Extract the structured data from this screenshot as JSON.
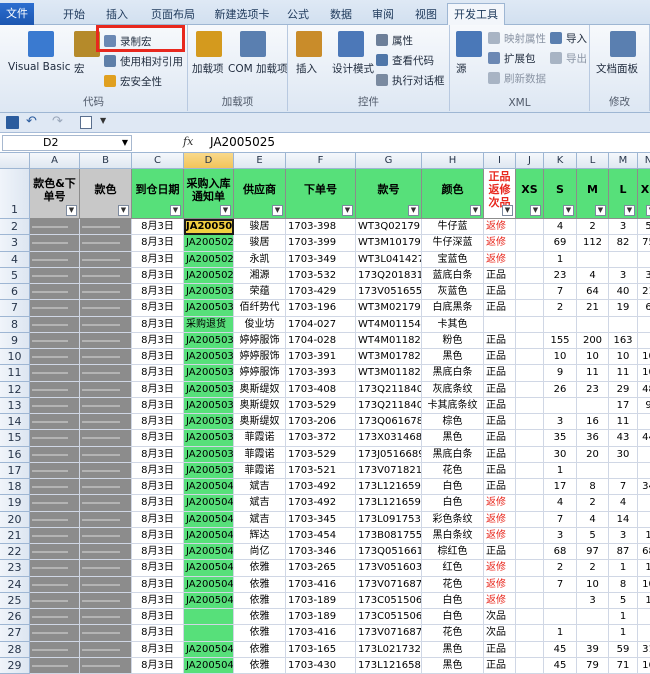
{
  "menu": {
    "tabs": [
      "文件",
      "开始",
      "插入",
      "页面布局",
      "新建选项卡",
      "公式",
      "数据",
      "审阅",
      "视图",
      "开发工具"
    ],
    "active": "开发工具"
  },
  "ribbon": {
    "code": {
      "vb": "Visual Basic",
      "macro": "宏",
      "record": "录制宏",
      "relative": "使用相对引用",
      "security": "宏安全性",
      "label": "代码"
    },
    "addins": {
      "addins": "加载项",
      "com": "COM 加载项",
      "label": "加载项"
    },
    "controls": {
      "insert": "插入",
      "design": "设计模式",
      "props": "属性",
      "viewcode": "查看代码",
      "dialog": "执行对话框",
      "label": "控件"
    },
    "xml": {
      "source": "源",
      "map": "映射属性",
      "ext": "扩展包",
      "refresh": "刷新数据",
      "import": "导入",
      "export": "导出",
      "label": "XML"
    },
    "modify": {
      "panel": "文档面板",
      "label": "修改"
    },
    "highlight": "#e8281e"
  },
  "formula": {
    "namebox": "D2",
    "fx": "fx",
    "value": "JA2005025"
  },
  "columns": [
    "A",
    "B",
    "C",
    "D",
    "E",
    "F",
    "G",
    "H",
    "I",
    "J",
    "K",
    "L",
    "M",
    "N"
  ],
  "headers": [
    "款色&下单号",
    "款色",
    "到仓日期",
    "采购入库通知单",
    "供应商",
    "下单号",
    "款号",
    "颜色",
    "正品返修次品",
    "XS",
    "S",
    "M",
    "L",
    "XL"
  ],
  "header_colors": {
    "gray": "#c8c8c8",
    "green": "#57e07a",
    "blank": "#ffffff"
  },
  "rows": [
    [
      "2",
      "",
      "",
      "8月3日",
      "JA2005025",
      "骏居",
      "1703-398",
      "WT3Q0217916",
      "牛仔蓝",
      "返修",
      "",
      "4",
      "2",
      "3",
      "5"
    ],
    [
      "3",
      "",
      "",
      "8月3日",
      "JA2005029",
      "骏居",
      "1703-399",
      "WT3M1017923",
      "牛仔深蓝",
      "返修",
      "",
      "69",
      "112",
      "82",
      "75"
    ],
    [
      "4",
      "",
      "",
      "8月3日",
      "JA2005022",
      "永凯",
      "1703-349",
      "WT3L0414275",
      "宝蓝色",
      "返修",
      "",
      "1",
      "",
      "",
      ""
    ],
    [
      "5",
      "",
      "",
      "8月3日",
      "JA2005028",
      "湘源",
      "1703-532",
      "173Q2018312",
      "蓝底白条",
      "正品",
      "",
      "23",
      "4",
      "3",
      "3"
    ],
    [
      "6",
      "",
      "",
      "8月3日",
      "JA2005030",
      "荣蕴",
      "1703-429",
      "173V0516555",
      "灰蓝色",
      "正品",
      "",
      "7",
      "64",
      "40",
      "21"
    ],
    [
      "7",
      "",
      "",
      "8月3日",
      "JA2005031",
      "佰纤势代",
      "1703-196",
      "WT3M0217901",
      "白底黑条",
      "正品",
      "",
      "2",
      "21",
      "19",
      "6"
    ],
    [
      "8",
      "",
      "",
      "8月3日",
      "采购退货",
      "俊业坊",
      "1704-027",
      "WT4M0115462",
      "卡其色",
      "",
      "",
      "",
      "",
      "",
      ""
    ],
    [
      "9",
      "",
      "",
      "8月3日",
      "JA2005036",
      "婷婷服饰",
      "1704-028",
      "WT4M0118269",
      "粉色",
      "正品",
      "",
      "155",
      "200",
      "163",
      ""
    ],
    [
      "10",
      "",
      "",
      "8月3日",
      "JA2005033",
      "婷婷服饰",
      "1703-391",
      "WT3M0178261",
      "黑色",
      "正品",
      "",
      "10",
      "10",
      "10",
      "10"
    ],
    [
      "11",
      "",
      "",
      "8月3日",
      "JA2005032",
      "婷婷服饰",
      "1703-393",
      "WT3M0118258",
      "黑底白条",
      "正品",
      "",
      "9",
      "11",
      "11",
      "10"
    ],
    [
      "12",
      "",
      "",
      "8月3日",
      "JA2005034",
      "奥斯缇奴",
      "1703-408",
      "173Q2118409",
      "灰底条纹",
      "正品",
      "",
      "26",
      "23",
      "29",
      "48"
    ],
    [
      "13",
      "",
      "",
      "8月3日",
      "JA2005035",
      "奥斯缇奴",
      "1703-529",
      "173Q2118409",
      "卡其底条纹",
      "正品",
      "",
      "",
      "",
      "17",
      "9"
    ],
    [
      "14",
      "",
      "",
      "8月3日",
      "JA2005037",
      "奥斯缇奴",
      "1703-206",
      "173Q0616787",
      "棕色",
      "正品",
      "",
      "3",
      "16",
      "11",
      ""
    ],
    [
      "15",
      "",
      "",
      "8月3日",
      "JA2005038",
      "菲霞诺",
      "1703-372",
      "173X0314684",
      "黑色",
      "正品",
      "",
      "35",
      "36",
      "43",
      "44"
    ],
    [
      "16",
      "",
      "",
      "8月3日",
      "JA2005037",
      "菲霞诺",
      "1703-529",
      "173J0516689",
      "黑底白条",
      "正品",
      "",
      "30",
      "20",
      "30",
      ""
    ],
    [
      "17",
      "",
      "",
      "8月3日",
      "JA2005039",
      "菲霞诺",
      "1703-521",
      "173V0718211",
      "花色",
      "正品",
      "",
      "1",
      "",
      "",
      ""
    ],
    [
      "18",
      "",
      "",
      "8月3日",
      "JA2005040",
      "斌吉",
      "1703-492",
      "173L1216590",
      "白色",
      "正品",
      "",
      "17",
      "8",
      "7",
      "34"
    ],
    [
      "19",
      "",
      "",
      "8月3日",
      "JA2005040",
      "斌吉",
      "1703-492",
      "173L1216590",
      "白色",
      "返修",
      "",
      "4",
      "2",
      "4",
      ""
    ],
    [
      "20",
      "",
      "",
      "8月3日",
      "JA2005041",
      "斌吉",
      "1703-345",
      "173L0917531",
      "彩色条纹",
      "返修",
      "",
      "7",
      "4",
      "14",
      ""
    ],
    [
      "21",
      "",
      "",
      "8月3日",
      "JA2005042",
      "辉达",
      "1703-454",
      "173B0817550",
      "黑白条纹",
      "返修",
      "",
      "3",
      "5",
      "3",
      "1"
    ],
    [
      "22",
      "",
      "",
      "8月3日",
      "JA2005044",
      "尚亿",
      "1703-346",
      "173Q0516616",
      "棕红色",
      "正品",
      "",
      "68",
      "97",
      "87",
      "68"
    ],
    [
      "23",
      "",
      "",
      "8月3日",
      "JA2005045",
      "依雅",
      "1703-265",
      "173V0516034",
      "红色",
      "返修",
      "",
      "2",
      "2",
      "1",
      "1"
    ],
    [
      "24",
      "",
      "",
      "8月3日",
      "JA2005046",
      "依雅",
      "1703-416",
      "173V0716870",
      "花色",
      "返修",
      "",
      "7",
      "10",
      "8",
      "10"
    ],
    [
      "25",
      "",
      "",
      "8月3日",
      "JA2005047",
      "依雅",
      "1703-189",
      "173C0515063",
      "白色",
      "返修",
      "",
      "",
      "3",
      "5",
      "1"
    ],
    [
      "26",
      "",
      "",
      "8月3日",
      "",
      "依雅",
      "1703-189",
      "173C0515063",
      "白色",
      "次品",
      "",
      "",
      "",
      "1",
      ""
    ],
    [
      "27",
      "",
      "",
      "8月3日",
      "",
      "依雅",
      "1703-416",
      "173V0716870",
      "花色",
      "次品",
      "",
      "1",
      "",
      "1",
      ""
    ],
    [
      "28",
      "",
      "",
      "8月3日",
      "JA2005048",
      "依雅",
      "1703-165",
      "173L0217325",
      "黑色",
      "正品",
      "",
      "45",
      "39",
      "59",
      "31"
    ],
    [
      "29",
      "",
      "",
      "8月3日",
      "JA2005049",
      "依雅",
      "1703-430",
      "173L1216588",
      "黑色",
      "正品",
      "",
      "45",
      "79",
      "71",
      "16"
    ]
  ],
  "status_colors": {
    "返修": "#e8281e",
    "正品": "#000000",
    "次品": "#000000"
  }
}
